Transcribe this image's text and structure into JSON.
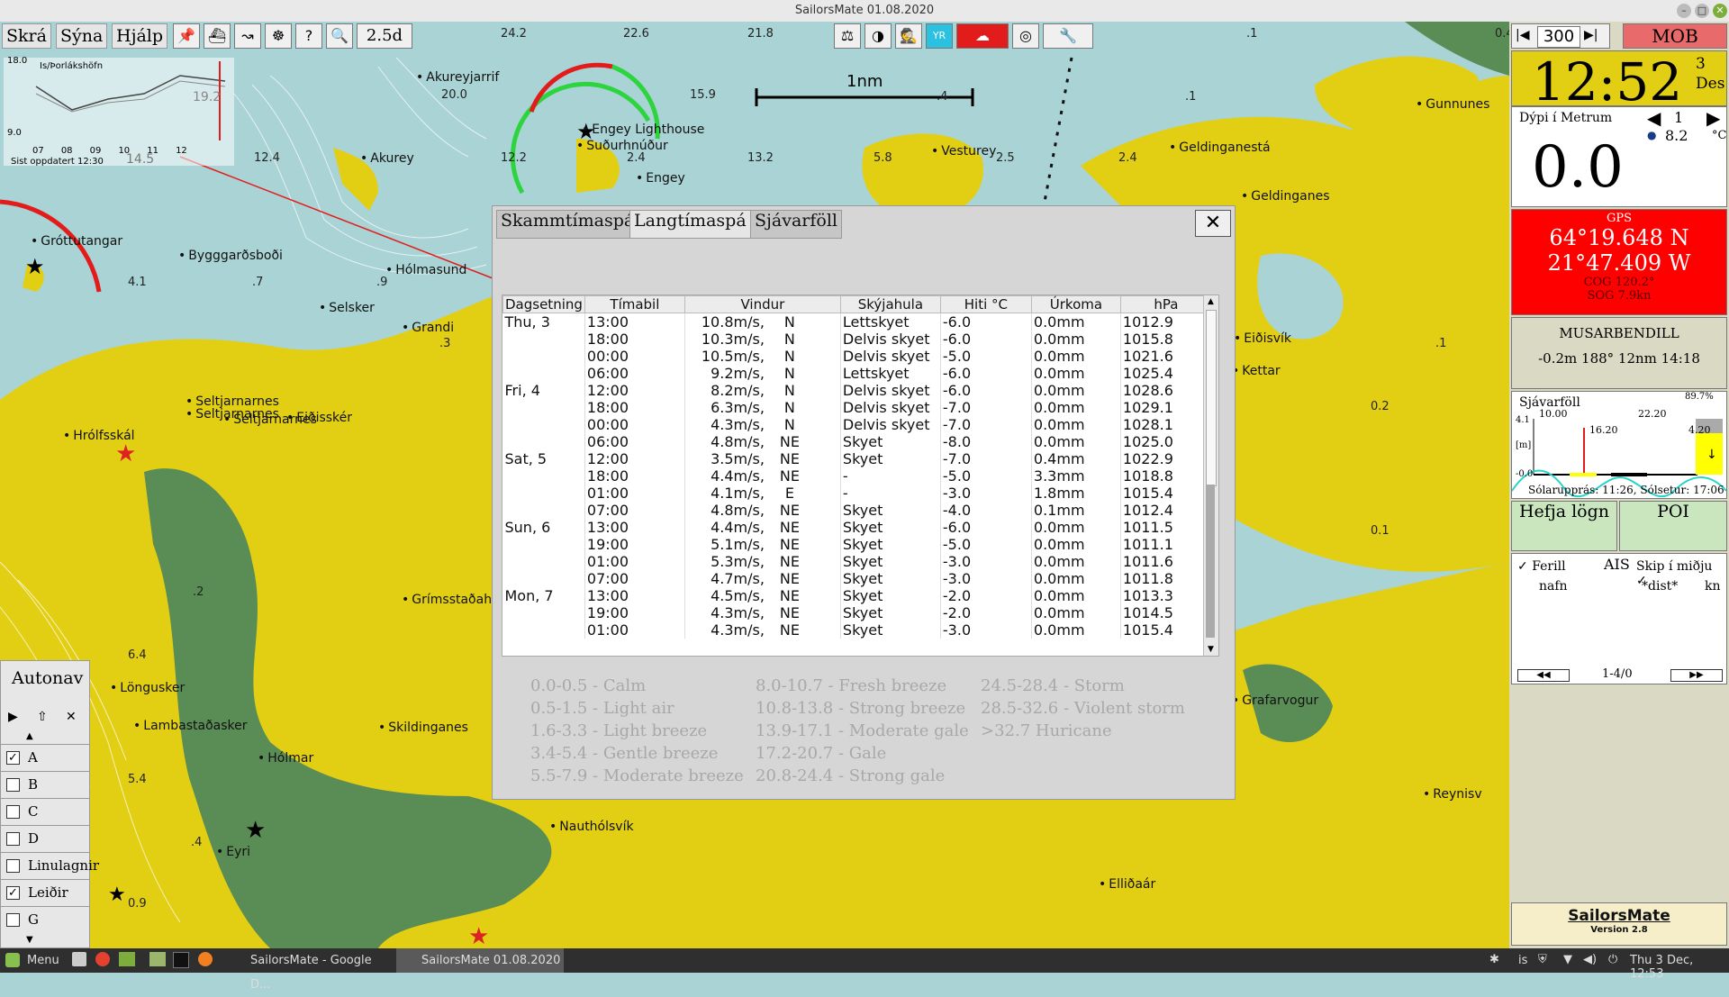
{
  "window": {
    "title": "SailorsMate 01.08.2020"
  },
  "menu": {
    "items": [
      "Skrá",
      "Sýna",
      "Hjálp"
    ],
    "zoom_label": "2.5d"
  },
  "scale": {
    "label": "1nm"
  },
  "forecast_graph": {
    "station": "Is/Þorlákshöfn",
    "y_max": "18.0",
    "y_min": "9.0",
    "value": "19.2",
    "value2": "14.5",
    "ticks": [
      "07",
      "08",
      "09",
      "10",
      "11",
      "12"
    ],
    "updated": "Sist oppdatert 12:30"
  },
  "map": {
    "places": [
      "Akureyjarrif",
      "Engey Lighthouse",
      "Suðurhnúður",
      "Engey",
      "Akurey",
      "Vesturey",
      "Geldinganestá",
      "Gunnunes",
      "Geldinganes",
      "Gróttutangar",
      "Bygggarðsboði",
      "Hólmasund",
      "Selsker",
      "Grandi",
      "Seltjarnarnes",
      "Seltjarnarnes",
      "Seltjarnarnes",
      "Eiðisskér",
      "Hrólfsskál",
      "Grímsstaðaho",
      "Löngusker",
      "Lambastaðasker",
      "Skildinganes",
      "Hólmar",
      "Eyri",
      "Nauthólsvík",
      "Elliðaár",
      "Grafarvogur",
      "Eiðisvík",
      "Kettar",
      "Reynisv"
    ],
    "depths": [
      "24.2",
      "22.6",
      "21.8",
      "20.0",
      "15.9",
      "12.4",
      "12.2",
      "2.4",
      "13.2",
      "5.8",
      "2.5",
      "2.4",
      ".1",
      ".1",
      "0.4",
      ".4",
      "4.1",
      ".7",
      ".9",
      ".3",
      ".2",
      "6.4",
      "5.4",
      ".4",
      "0.9",
      ".1",
      "0.2",
      "0.1"
    ]
  },
  "dialog": {
    "tabs": [
      "Skammtímaspá",
      "Langtímaspá",
      "Sjávarföll"
    ],
    "active_tab": "Langtímaspá",
    "close_label": "✕",
    "columns": [
      "Dagsetning",
      "Tímabil",
      "Vindur",
      "Skýjahula",
      "Hiti °C",
      "Úrkoma",
      "hPa"
    ],
    "rows": [
      [
        "Thu, 3",
        "13:00",
        "10.8m/s,",
        "N",
        "Lettskyet",
        "-6.0",
        "0.0mm",
        "1012.9"
      ],
      [
        "",
        "18:00",
        "10.3m/s,",
        "N",
        "Delvis skyet",
        "-6.0",
        "0.0mm",
        "1015.8"
      ],
      [
        "",
        "00:00",
        "10.5m/s,",
        "N",
        "Delvis skyet",
        "-5.0",
        "0.0mm",
        "1021.6"
      ],
      [
        "",
        "06:00",
        "9.2m/s,",
        "N",
        "Lettskyet",
        "-6.0",
        "0.0mm",
        "1025.4"
      ],
      [
        "Fri, 4",
        "12:00",
        "8.2m/s,",
        "N",
        "Delvis skyet",
        "-6.0",
        "0.0mm",
        "1028.6"
      ],
      [
        "",
        "18:00",
        "6.3m/s,",
        "N",
        "Delvis skyet",
        "-7.0",
        "0.0mm",
        "1029.1"
      ],
      [
        "",
        "00:00",
        "4.3m/s,",
        "N",
        "Delvis skyet",
        "-7.0",
        "0.0mm",
        "1028.1"
      ],
      [
        "",
        "06:00",
        "4.8m/s,",
        "NE",
        "Skyet",
        "-8.0",
        "0.0mm",
        "1025.0"
      ],
      [
        "Sat, 5",
        "12:00",
        "3.5m/s,",
        "NE",
        "Skyet",
        "-7.0",
        "0.4mm",
        "1022.9"
      ],
      [
        "",
        "18:00",
        "4.4m/s,",
        "NE",
        "-",
        "-5.0",
        "3.3mm",
        "1018.8"
      ],
      [
        "",
        "01:00",
        "4.1m/s,",
        "E",
        "-",
        "-3.0",
        "1.8mm",
        "1015.4"
      ],
      [
        "",
        "07:00",
        "4.8m/s,",
        "NE",
        "Skyet",
        "-4.0",
        "0.1mm",
        "1012.4"
      ],
      [
        "Sun, 6",
        "13:00",
        "4.4m/s,",
        "NE",
        "Skyet",
        "-6.0",
        "0.0mm",
        "1011.5"
      ],
      [
        "",
        "19:00",
        "5.1m/s,",
        "NE",
        "Skyet",
        "-5.0",
        "0.0mm",
        "1011.1"
      ],
      [
        "",
        "01:00",
        "5.3m/s,",
        "NE",
        "Skyet",
        "-3.0",
        "0.0mm",
        "1011.6"
      ],
      [
        "",
        "07:00",
        "4.7m/s,",
        "NE",
        "Skyet",
        "-3.0",
        "0.0mm",
        "1011.8"
      ],
      [
        "Mon, 7",
        "13:00",
        "4.5m/s,",
        "NE",
        "Skyet",
        "-2.0",
        "0.0mm",
        "1013.3"
      ],
      [
        "",
        "19:00",
        "4.3m/s,",
        "NE",
        "Skyet",
        "-2.0",
        "0.0mm",
        "1014.5"
      ],
      [
        "",
        "01:00",
        "4.3m/s,",
        "NE",
        "Skyet",
        "-3.0",
        "0.0mm",
        "1015.4"
      ]
    ],
    "legend": [
      "0.0-0.5 - Calm",
      "0.5-1.5 - Light air",
      "1.6-3.3 - Light breeze",
      "3.4-5.4 - Gentle breeze",
      "5.5-7.9 - Moderate breeze",
      "8.0-10.7 - Fresh breeze",
      "10.8-13.8 - Strong breeze",
      "13.9-17.1 - Moderate gale",
      "17.2-20.7 - Gale",
      "20.8-24.4 - Strong gale",
      "24.5-28.4 - Storm",
      "28.5-32.6 - Violent storm",
      ">32.7 Huricane"
    ]
  },
  "right_panel": {
    "range_value": "300",
    "mob_label": "MOB",
    "time": "12:52",
    "date_day": "3",
    "date_month": "Des",
    "depth_label": "Dýpi í Metrum",
    "depth_value": "0.0",
    "page_index": "1",
    "water_temp": "8.2",
    "temp_unit": "°C",
    "gps_label": "GPS",
    "lat": "64°19.648 N",
    "lon": "21°47.409 W",
    "cog": "COG 120.2°",
    "sog": "SOG 7.9kn",
    "waypoint_name": "MUSARBENDILL",
    "waypoint_info": "-0.2m  188°  12nm  14:18",
    "tide_label": "Sjávarföll",
    "tide_pct": "89.7%",
    "tide_scale": "4.1",
    "tide_unit": "[m]",
    "tide_zero": "-0.0",
    "tide_times": [
      "10.00",
      "16.20",
      "22.20",
      "4.20"
    ],
    "sun_text": "Sólarupprás: 11:26, Sólsetur: 17:06",
    "btn_log": "Hefja lögn",
    "btn_poi": "POI",
    "ais_label": "AIS",
    "ais_ferill": "Ferill",
    "ais_ship": "Skip í miðju",
    "ais_nafn": "nafn",
    "ais_dist": "*dist*",
    "ais_kn": "kn",
    "ais_page": "1-4/0",
    "brand": "SailorsMate",
    "version": "Version 2.8"
  },
  "left_panel": {
    "title": "Autonav",
    "layers": [
      {
        "label": "A",
        "checked": true
      },
      {
        "label": "B",
        "checked": false
      },
      {
        "label": "C",
        "checked": false
      },
      {
        "label": "D",
        "checked": false
      },
      {
        "label": "Linulagnir",
        "checked": false
      },
      {
        "label": "Leiðir",
        "checked": true
      },
      {
        "label": "G",
        "checked": false
      }
    ]
  },
  "taskbar": {
    "menu_label": "Menu",
    "apps": [
      "SailorsMate - Google D...",
      "SailorsMate 01.08.2020"
    ],
    "locale": "is",
    "clock": "Thu 3 Dec, 12:53"
  },
  "colors": {
    "land": "#e2cf14",
    "shallow": "#a9d3d4",
    "green": "#5a8c55",
    "gps_bg": "#ff0000",
    "mob": "#e86a6a"
  }
}
